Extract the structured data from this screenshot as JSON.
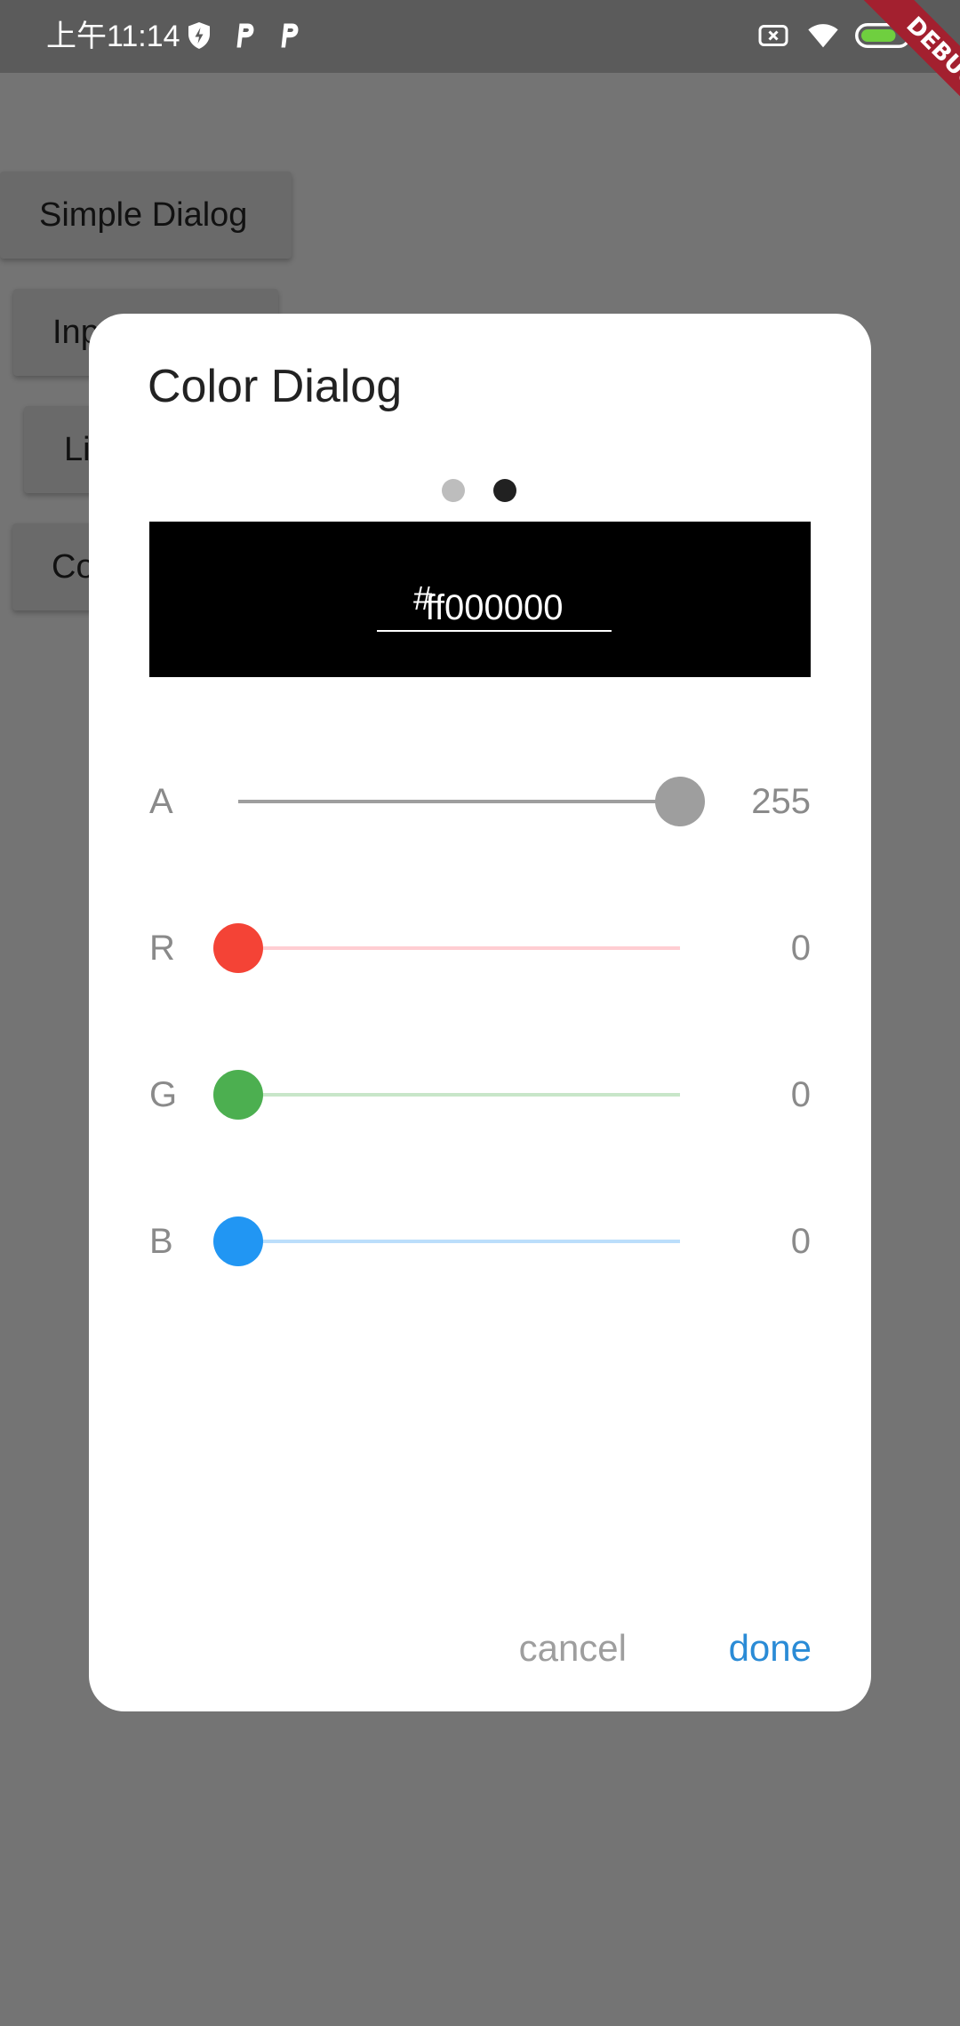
{
  "status_bar": {
    "time": "上午11:14",
    "left_icons": [
      "shield-bolt-icon",
      "parking-icon",
      "parking-icon"
    ],
    "right_icons": [
      "sim-disabled-icon",
      "wifi-icon",
      "battery-charging-icon"
    ],
    "debug_banner": "DEBUG"
  },
  "background": {
    "buttons": [
      "Simple Dialog",
      "Inp",
      "Li",
      "Co"
    ]
  },
  "dialog": {
    "title": "Color Dialog",
    "page_indicator": {
      "count": 2,
      "active": 2
    },
    "preview": {
      "hash": "#",
      "hex": "ff000000",
      "color": "#000000"
    },
    "sliders": [
      {
        "label": "A",
        "value": "255",
        "fraction": 1.0,
        "thumb_color": "#9e9e9e",
        "track_color": "#9e9e9e"
      },
      {
        "label": "R",
        "value": "0",
        "fraction": 0.0,
        "thumb_color": "#f44336",
        "track_color": "#ffcdd2"
      },
      {
        "label": "G",
        "value": "0",
        "fraction": 0.0,
        "thumb_color": "#4caf50",
        "track_color": "#c8e6c9"
      },
      {
        "label": "B",
        "value": "0",
        "fraction": 0.0,
        "thumb_color": "#2196f3",
        "track_color": "#bbdefb"
      }
    ],
    "actions": {
      "cancel": "cancel",
      "done": "done"
    }
  },
  "colors": {
    "scrim": "#747474",
    "accent": "#2a8bd6"
  }
}
